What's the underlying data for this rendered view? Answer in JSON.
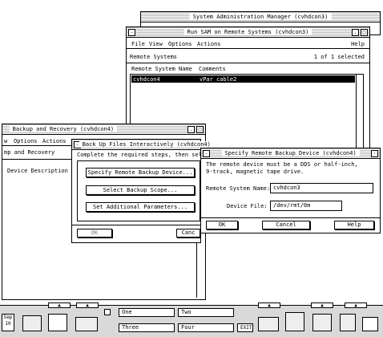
{
  "sam": {
    "title": "System Administration Manager (cvhdcon3)"
  },
  "remote": {
    "title": "Run SAM on Remote Systems (cvhdcon3)",
    "menu": [
      "File",
      "View",
      "Options",
      "Actions"
    ],
    "help": "Help",
    "list_title": "Remote Systems",
    "count": "1 of 1 selected",
    "col1": "Remote System Name",
    "col2": "Comments",
    "row_name": "cvhdcon4",
    "row_comment": "vPar cable2"
  },
  "backup": {
    "title": "Backup and Recovery (cvhdcon4)",
    "menu": [
      "w",
      "Options",
      "Actions"
    ],
    "heading": "mp and Recovery",
    "col": "Device Description"
  },
  "interactive": {
    "title": "Back Up Files Interactively (cvhdcon4)",
    "instruction": "Complete the required steps, then sele",
    "buttons": [
      "Specify Remote Backup Device...",
      "Select Backup Scope...",
      "Set Additional Parameters..."
    ],
    "ok": "OK",
    "cancel": "Canc"
  },
  "device": {
    "title": "Specify Remote Backup Device (cvhdcon4)",
    "desc1": "The remote device must be a DDS or half-inch,",
    "desc2": "9-track, magnetic tape drive.",
    "system_label": "Remote System Name:",
    "system_value": "cvhdcon3",
    "file_label": "Device File:",
    "file_value": "/dev/rmt/0m",
    "ok": "OK",
    "cancel": "Cancel",
    "help": "Help"
  },
  "panel": {
    "date_month": "Sep",
    "date_day": "10",
    "workspaces": [
      "One",
      "Two",
      "Three",
      "Four"
    ],
    "exit": "EXIT"
  }
}
